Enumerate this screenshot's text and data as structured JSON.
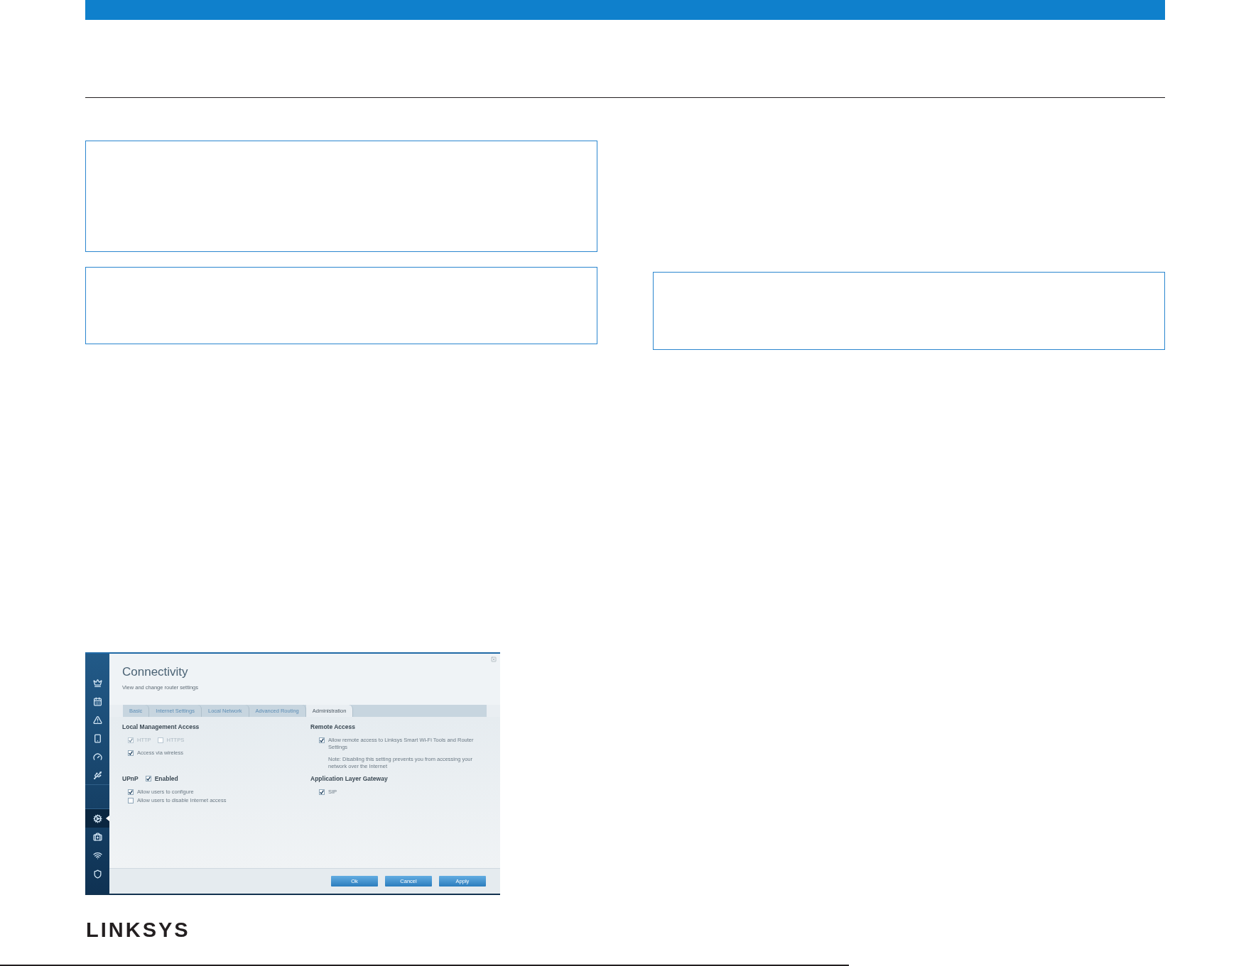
{
  "app_screenshot": {
    "sidebar": {
      "groups": [
        [
          {
            "selected": false
          },
          {
            "selected": false
          },
          {
            "selected": false
          },
          {
            "selected": false
          },
          {
            "selected": false
          },
          {
            "selected": false
          }
        ],
        [
          {
            "selected": true
          },
          {
            "selected": false
          },
          {
            "selected": false
          },
          {
            "selected": false
          }
        ]
      ]
    },
    "title": "Connectivity",
    "subtitle": "View and change router settings",
    "tabs": [
      {
        "label": "Basic",
        "selected": false
      },
      {
        "label": "Internet Settings",
        "selected": false
      },
      {
        "label": "Local Network",
        "selected": false
      },
      {
        "label": "Advanced Routing",
        "selected": false
      },
      {
        "label": "Administration",
        "selected": true
      }
    ],
    "columns": [
      [
        {
          "heading": "Local Management Access",
          "rows": [
            [
              {
                "label": "HTTP",
                "checked": true,
                "disabled": true
              },
              {
                "label": "HTTPS",
                "checked": false,
                "disabled": true
              }
            ],
            [
              {
                "label": "Access via wireless",
                "checked": true,
                "disabled": false
              }
            ]
          ]
        },
        {
          "heading": "UPnP",
          "toggle": {
            "label": "Enabled",
            "checked": true
          },
          "rows": [
            [
              {
                "label": "Allow users to configure",
                "checked": true,
                "disabled": false
              }
            ],
            [
              {
                "label": "Allow users to disable Internet access",
                "checked": false,
                "disabled": false
              }
            ]
          ]
        }
      ],
      [
        {
          "heading": "Remote Access",
          "rows": [
            [
              {
                "label": "Allow remote access to Linksys Smart Wi-Fi Tools and Router Settings",
                "checked": true,
                "disabled": false
              }
            ]
          ],
          "note": "Note: Disabling this setting prevents you from accessing your network over the Internet"
        },
        {
          "heading": "Application Layer Gateway",
          "rows": [
            [
              {
                "label": "SIP",
                "checked": true,
                "disabled": false
              }
            ]
          ]
        }
      ]
    ],
    "buttons": [
      "Ok",
      "Cancel",
      "Apply"
    ]
  },
  "footer": {
    "logo": "LINKSYS"
  }
}
